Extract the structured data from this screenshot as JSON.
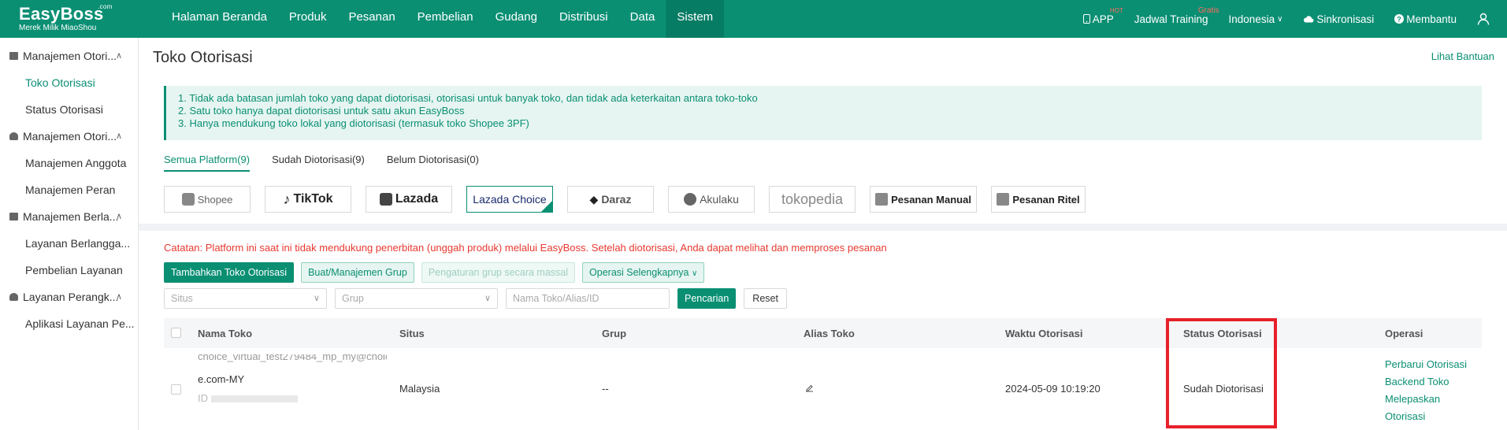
{
  "brand": {
    "name": "EasyBoss",
    "com": ".com",
    "subtitle": "Merek Milik MiaoShou"
  },
  "nav": [
    "Halaman Beranda",
    "Produk",
    "Pesanan",
    "Pembelian",
    "Gudang",
    "Distribusi",
    "Data",
    "Sistem"
  ],
  "nav_active": "Sistem",
  "topright": {
    "app": "APP",
    "hot": "HOT",
    "training": "Jadwal Training",
    "gratis": "Gratis",
    "language": "Indonesia",
    "sync": "Sinkronisasi",
    "help": "Membantu"
  },
  "sidebar": {
    "groups": [
      {
        "label": "Manajemen Otori...",
        "items": [
          "Toko Otorisasi",
          "Status Otorisasi"
        ]
      },
      {
        "label": "Manajemen Otori...",
        "items": [
          "Manajemen Anggota",
          "Manajemen Peran"
        ]
      },
      {
        "label": "Manajemen Berla...",
        "items": [
          "Layanan Berlangga...",
          "Pembelian Layanan"
        ]
      },
      {
        "label": "Layanan Perangk...",
        "items": [
          "Aplikasi Layanan Pe..."
        ]
      }
    ],
    "active_item": "Toko Otorisasi"
  },
  "page": {
    "title": "Toko Otorisasi",
    "help_link": "Lihat Bantuan",
    "notice": [
      "1. Tidak ada batasan jumlah toko yang dapat diotorisasi, otorisasi untuk banyak toko, dan tidak ada keterkaitan antara toko-toko",
      "2. Satu toko hanya dapat diotorisasi untuk satu akun EasyBoss",
      "3. Hanya mendukung toko lokal yang diotorisasi (termasuk toko Shopee 3PF)"
    ],
    "tabs": [
      "Semua Platform(9)",
      "Sudah Diotorisasi(9)",
      "Belum Diotorisasi(0)"
    ],
    "platforms": [
      "Shopee",
      "TikTok",
      "Lazada",
      "Lazada Choice",
      "Daraz",
      "Akulaku",
      "tokopedia",
      "Pesanan Manual",
      "Pesanan Ritel"
    ],
    "selected_platform": "Lazada Choice"
  },
  "content": {
    "note": "Catatan: Platform ini saat ini tidak mendukung penerbitan (unggah produk) melalui EasyBoss. Setelah diotorisasi, Anda dapat melihat dan memproses pesanan",
    "actions": {
      "add": "Tambahkan Toko Otorisasi",
      "group": "Buat/Manajemen Grup",
      "bulk": "Pengaturan grup secara massal",
      "more": "Operasi Selengkapnya"
    },
    "filters": {
      "site": "Situs",
      "group": "Grup",
      "search_placeholder": "Nama Toko/Alias/ID",
      "search": "Pencarian",
      "reset": "Reset"
    },
    "columns": [
      "Nama Toko",
      "Situs",
      "Grup",
      "Alias Toko",
      "Waktu Otorisasi",
      "Status Otorisasi",
      "Operasi"
    ],
    "rows": [
      {
        "name_line1": "choice_virtual_test279484_mp_my@choic",
        "name_line2": "e.com-MY",
        "name_line3": "ID",
        "site": "Malaysia",
        "group": "--",
        "time": "2024-05-09 10:19:20",
        "status": "Sudah Diotorisasi",
        "ops": [
          "Perbarui Otorisasi",
          "Backend Toko",
          "Melepaskan Otorisasi"
        ]
      }
    ]
  }
}
